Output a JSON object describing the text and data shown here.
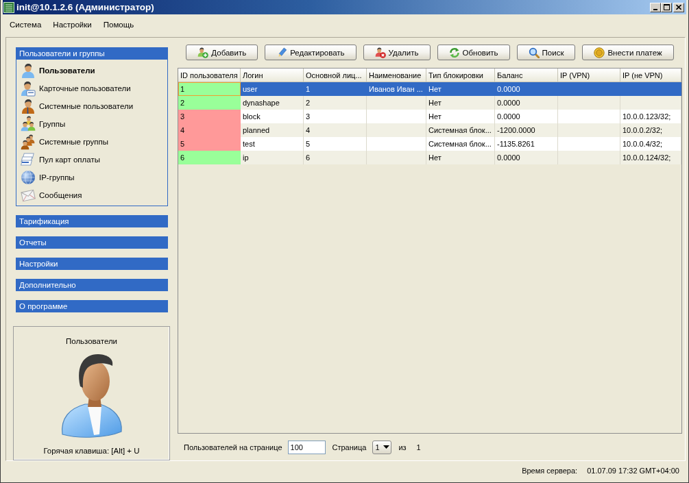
{
  "window": {
    "title": "init@10.1.2.6 (Администратор)"
  },
  "menu": [
    {
      "label": "Система"
    },
    {
      "label": "Настройки"
    },
    {
      "label": "Помощь"
    }
  ],
  "sidebar": {
    "sections": [
      {
        "title": "Пользователи и группы",
        "items": [
          {
            "label": "Пользователи",
            "selected": true
          },
          {
            "label": "Карточные пользователи",
            "selected": false
          },
          {
            "label": "Системные пользователи",
            "selected": false
          },
          {
            "label": "Группы",
            "selected": false
          },
          {
            "label": "Системные группы",
            "selected": false
          },
          {
            "label": "Пул карт оплаты",
            "selected": false
          },
          {
            "label": "IP-группы",
            "selected": false
          },
          {
            "label": "Сообщения",
            "selected": false
          }
        ]
      },
      {
        "title": "Тарификация"
      },
      {
        "title": "Отчеты"
      },
      {
        "title": "Настройки"
      },
      {
        "title": "Дополнительно"
      },
      {
        "title": "О программе"
      }
    ],
    "preview": {
      "title": "Пользователи",
      "hotkey": "Горячая клавиша: [Alt] + U"
    }
  },
  "toolbar": {
    "buttons": [
      {
        "label": "Добавить"
      },
      {
        "label": "Редактировать"
      },
      {
        "label": "Удалить"
      },
      {
        "label": "Обновить"
      },
      {
        "label": "Поиск"
      },
      {
        "label": "Внести платеж"
      }
    ]
  },
  "table": {
    "columns": [
      "ID пользователя",
      "Логин",
      "Основной лиц...",
      "Наименование",
      "Тип блокировки",
      "Баланс",
      "IP (VPN)",
      "IP (не VPN)"
    ],
    "rows": [
      {
        "id": "1",
        "login": "user",
        "column_3": "1",
        "name": "Иванов Иван ...",
        "block_type": "Нет",
        "balance": "0.0000",
        "selected": true,
        "focused": true,
        "color": "#99ff99"
      },
      {
        "id": "2",
        "login": "dynashape",
        "column_3": "2",
        "block_type": "Нет",
        "balance": "0.0000",
        "selected": false,
        "focused": false,
        "color": "#99ff99"
      },
      {
        "id": "3",
        "login": "block",
        "column_3": "3",
        "block_type": "Нет",
        "balance": "0.0000",
        "ip_non_vpn": "10.0.0.123/32;",
        "selected": false,
        "focused": false,
        "color": "#ff9999"
      },
      {
        "id": "4",
        "login": "planned",
        "column_3": "4",
        "block_type": "Системная блок...",
        "balance": "-1200.0000",
        "ip_non_vpn": "10.0.0.2/32;",
        "selected": false,
        "focused": false,
        "color": "#ff9999"
      },
      {
        "id": "5",
        "login": "test",
        "column_3": "5",
        "block_type": "Системная блок...",
        "balance": "-1135.8261",
        "ip_non_vpn": "10.0.0.4/32;",
        "selected": false,
        "focused": false,
        "color": "#ff9999"
      },
      {
        "id": "6",
        "login": "ip",
        "column_3": "6",
        "block_type": "Нет",
        "balance": "0.0000",
        "ip_non_vpn": "10.0.0.124/32;",
        "selected": false,
        "focused": false,
        "color": "#99ff99"
      }
    ]
  },
  "pager": {
    "per_page_label": "Пользователей на странице",
    "per_page": "100",
    "page_label": "Страница",
    "page": "1",
    "of_label": "из",
    "page_count": "1"
  },
  "status_bar": {
    "label": "Время сервера:",
    "value": "01.07.09 17:32 GMT+04:00"
  }
}
